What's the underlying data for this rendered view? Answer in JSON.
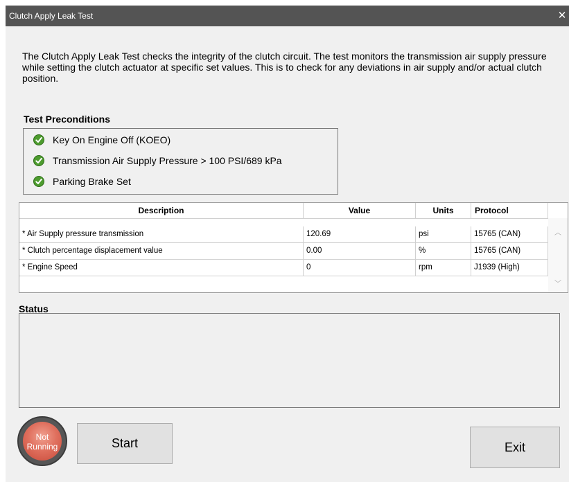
{
  "window": {
    "title": "Clutch Apply Leak Test",
    "close_glyph": "✕"
  },
  "intro_text": "The Clutch Apply Leak Test checks the integrity of the clutch circuit. The test monitors the transmission air supply pressure while setting the clutch actuator at specific set values. This is to check for any deviations in air supply and/or actual clutch position.",
  "preconditions": {
    "heading": "Test Preconditions",
    "items": [
      {
        "label": "Key On Engine Off (KOEO)",
        "icon": "check-circle-icon",
        "status": "met"
      },
      {
        "label": "Transmission Air Supply Pressure > 100 PSI/689 kPa",
        "icon": "check-circle-icon",
        "status": "met"
      },
      {
        "label": "Parking Brake Set",
        "icon": "check-circle-icon",
        "status": "met"
      }
    ]
  },
  "grid": {
    "columns": [
      "Description",
      "Value",
      "Units",
      "Protocol"
    ],
    "rows": [
      {
        "description": "* Air Supply pressure transmission",
        "value": "120.69",
        "units": "psi",
        "protocol": "15765 (CAN)"
      },
      {
        "description": "* Clutch percentage displacement value",
        "value": "0.00",
        "units": "%",
        "protocol": "15765 (CAN)"
      },
      {
        "description": "* Engine Speed",
        "value": "0",
        "units": "rpm",
        "protocol": "J1939 (High)"
      }
    ]
  },
  "status": {
    "heading": "Status",
    "text": ""
  },
  "indicator": {
    "line1": "Not",
    "line2": "Running"
  },
  "buttons": {
    "start": "Start",
    "exit": "Exit"
  },
  "colors": {
    "titlebar": "#545454",
    "check_green": "#4d9b2e",
    "indicator_red": "#d95a48"
  }
}
